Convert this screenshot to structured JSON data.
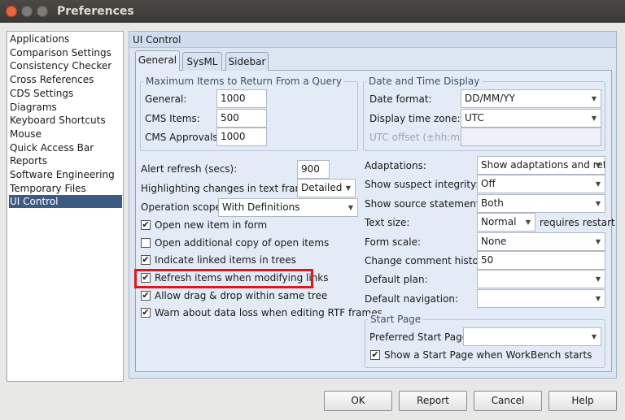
{
  "window": {
    "title": "Preferences"
  },
  "sidebar": {
    "items": [
      "Applications",
      "Comparison Settings",
      "Consistency Checker",
      "Cross References",
      "CDS Settings",
      "Diagrams",
      "Keyboard Shortcuts",
      "Mouse",
      "Quick Access Bar",
      "Reports",
      "Software Engineering",
      "Temporary Files",
      "UI Control"
    ],
    "selected": "UI Control"
  },
  "panel": {
    "title": "UI Control",
    "tabs": [
      "General",
      "SysML",
      "Sidebar"
    ],
    "active_tab": "General"
  },
  "max_items": {
    "title": "Maximum Items to Return From a Query",
    "general_label": "General:",
    "general": "1000",
    "cms_items_label": "CMS Items:",
    "cms_items": "500",
    "cms_approvals_label": "CMS Approvals:",
    "cms_approvals": "1000"
  },
  "datetime": {
    "title": "Date and Time Display",
    "date_format_label": "Date format:",
    "date_format": "DD/MM/YY",
    "tz_label": "Display time zone:",
    "tz": "UTC",
    "utc_offset_label": "UTC offset (±hh:mm):",
    "utc_offset": ""
  },
  "general": {
    "alert_label": "Alert refresh (secs):",
    "alert": "900",
    "highlight_label": "Highlighting changes in text frames:",
    "highlight": "Detailed",
    "scope_label": "Operation scope:",
    "scope": "With Definitions"
  },
  "checkboxes": [
    {
      "label": "Open new item in form",
      "checked": true
    },
    {
      "label": "Open additional copy of open items",
      "checked": false
    },
    {
      "label": "Indicate linked items in trees",
      "checked": true
    },
    {
      "label": "Refresh items when modifying links",
      "checked": true,
      "highlighted": true
    },
    {
      "label": "Allow drag & drop within same tree",
      "checked": true
    },
    {
      "label": "Warn about data loss when editing RTF frames",
      "checked": true
    }
  ],
  "right": {
    "rows": [
      {
        "label": "Adaptations:",
        "value": "Show adaptations and refe"
      },
      {
        "label": "Show suspect integrity:",
        "value": "Off"
      },
      {
        "label": "Show source statements:",
        "value": "Both"
      },
      {
        "label": "Text size:",
        "value": "Normal",
        "note": "requires restart"
      },
      {
        "label": "Form scale:",
        "value": "None"
      },
      {
        "label": "Change comment history:",
        "value": "50"
      },
      {
        "label": "Default plan:",
        "value": ""
      },
      {
        "label": "Default navigation:",
        "value": ""
      }
    ]
  },
  "start_page": {
    "title": "Start Page",
    "preferred_label": "Preferred Start Page:",
    "preferred": "",
    "show_label": "Show a Start Page when WorkBench starts",
    "show_checked": true
  },
  "buttons": {
    "ok": "OK",
    "report": "Report",
    "cancel": "Cancel",
    "help": "Help"
  },
  "colors": {
    "highlight_box": "#e0161c",
    "selection": "#3d5b82",
    "panel": "#dce6f3"
  }
}
